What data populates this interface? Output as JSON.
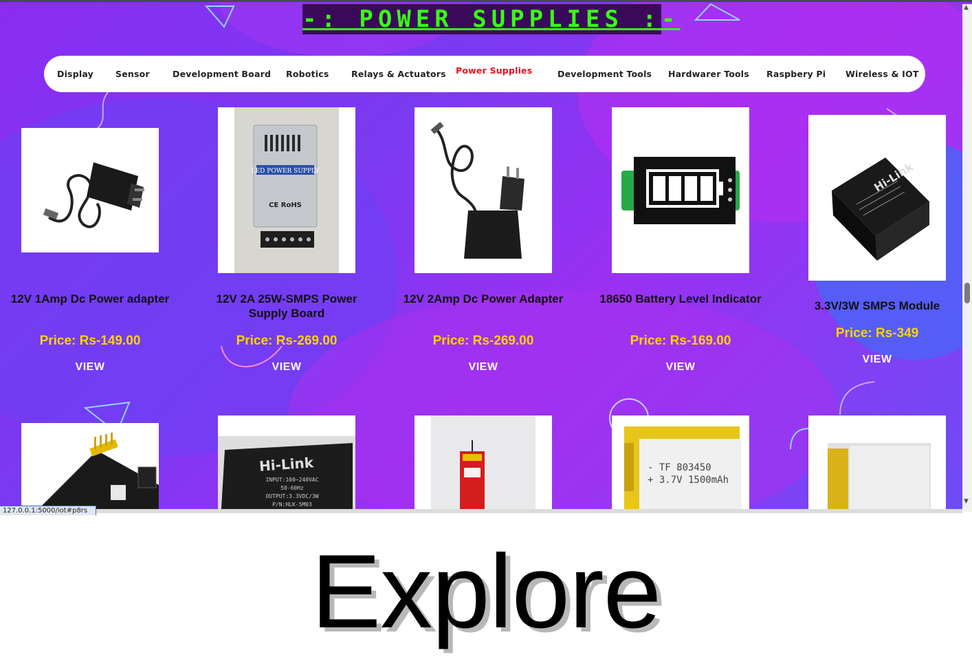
{
  "page": {
    "heading": "-: POWER SUPPLIES :-",
    "status_url": "127.0.0.1:5000/iot#p8rs",
    "caption": "Explore"
  },
  "nav": {
    "items": [
      {
        "label": "Display"
      },
      {
        "label": "Sensor"
      },
      {
        "label": "Development Board"
      },
      {
        "label": "Robotics"
      },
      {
        "label": "Relays & Actuators"
      },
      {
        "label": "Power Supplies",
        "active": true
      },
      {
        "label": "Development Tools"
      },
      {
        "label": "Hardwarer Tools"
      },
      {
        "label": "Raspbery Pi"
      },
      {
        "label": "Wireless & IOT"
      }
    ]
  },
  "products": [
    {
      "name": "12V 1Amp Dc Power adapter",
      "price": "Price: Rs-149.00",
      "view": "VIEW",
      "image": "dc-adapter-image"
    },
    {
      "name": "12V 2A 25W-SMPS Power Supply Board",
      "price": "Price: Rs-269.00",
      "view": "VIEW",
      "image": "smps-board-image",
      "image_text": {
        "line1": "LED POWER SUPPLY",
        "line2": "CE RoHS"
      }
    },
    {
      "name": "12V 2Amp Dc Power Adapter",
      "price": "Price: Rs-269.00",
      "view": "VIEW",
      "image": "dc-adapter-image"
    },
    {
      "name": "18650 Battery Level Indicator",
      "price": "Price: Rs-169.00",
      "view": "VIEW",
      "image": "battery-indicator-image"
    },
    {
      "name": "3.3V/3W SMPS Module",
      "price": "Price: Rs-349",
      "view": "VIEW",
      "image": "hilink-module-image",
      "image_text": {
        "brand": "Hi-Link"
      }
    }
  ],
  "products_row2": [
    {
      "image": "breadboard-power-module-image"
    },
    {
      "image": "hilink-module-image",
      "image_text": {
        "brand": "Hi-Link",
        "line1": "INPUT:100~240VAC",
        "line2": "50-60Hz",
        "line3": "OUTPUT:3.3VDC/3W",
        "line4": "P/N:HLK-5M03"
      }
    },
    {
      "image": "lipo-battery-thin-image"
    },
    {
      "image": "lipo-battery-image",
      "image_text": {
        "line1": "- TF 803450",
        "line2": "+ 3.7V 1500mAh"
      }
    },
    {
      "image": "lipo-battery-small-image"
    }
  ],
  "colors": {
    "heading_text": "#39ff14",
    "heading_bg": "#3a0a5a",
    "nav_active": "#e8101a",
    "price": "#ffd200",
    "view": "#ffffff",
    "background": "#8a2cf2"
  }
}
